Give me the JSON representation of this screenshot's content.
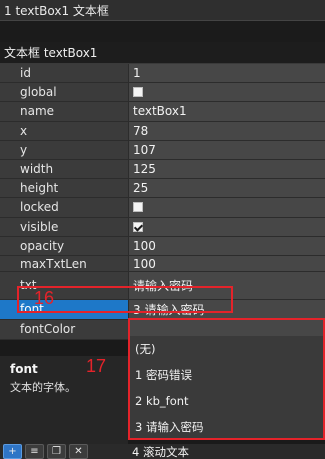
{
  "selector": {
    "label": "1  textBox1  文本框"
  },
  "header": {
    "title": "文本框 textBox1"
  },
  "properties": [
    {
      "name": "id",
      "value": "1",
      "type": "text"
    },
    {
      "name": "global",
      "value": "",
      "type": "checkbox",
      "checked": false
    },
    {
      "name": "name",
      "value": "textBox1",
      "type": "text"
    },
    {
      "name": "x",
      "value": "78",
      "type": "text"
    },
    {
      "name": "y",
      "value": "107",
      "type": "text"
    },
    {
      "name": "width",
      "value": "125",
      "type": "text"
    },
    {
      "name": "height",
      "value": "25",
      "type": "text"
    },
    {
      "name": "locked",
      "value": "",
      "type": "checkbox",
      "checked": false
    },
    {
      "name": "visible",
      "value": "",
      "type": "checkbox",
      "checked": true
    },
    {
      "name": "opacity",
      "value": "100",
      "type": "text"
    },
    {
      "name": "maxTxtLen",
      "value": "100",
      "type": "text"
    },
    {
      "name": "txt",
      "value": "请输入密码",
      "type": "text"
    },
    {
      "name": "font",
      "value": "3 请输入密码",
      "type": "text",
      "selected": true
    },
    {
      "name": "fontColor",
      "value": "",
      "type": "text"
    }
  ],
  "description": {
    "title": "font",
    "text": "文本的字体。"
  },
  "dropdown": {
    "options": [
      "(无)",
      "1 密码错误",
      "2 kb_font",
      "3 请输入密码",
      "4 滚动文本"
    ]
  },
  "annotations": {
    "num_16": "16",
    "num_17": "17",
    "color": "#e4232a"
  },
  "toolbar": {
    "icons": [
      "add-icon",
      "list-icon",
      "copy-icon",
      "delete-icon"
    ]
  },
  "colors": {
    "selected_row": "#1e78c8",
    "annotation": "#e4232a"
  }
}
